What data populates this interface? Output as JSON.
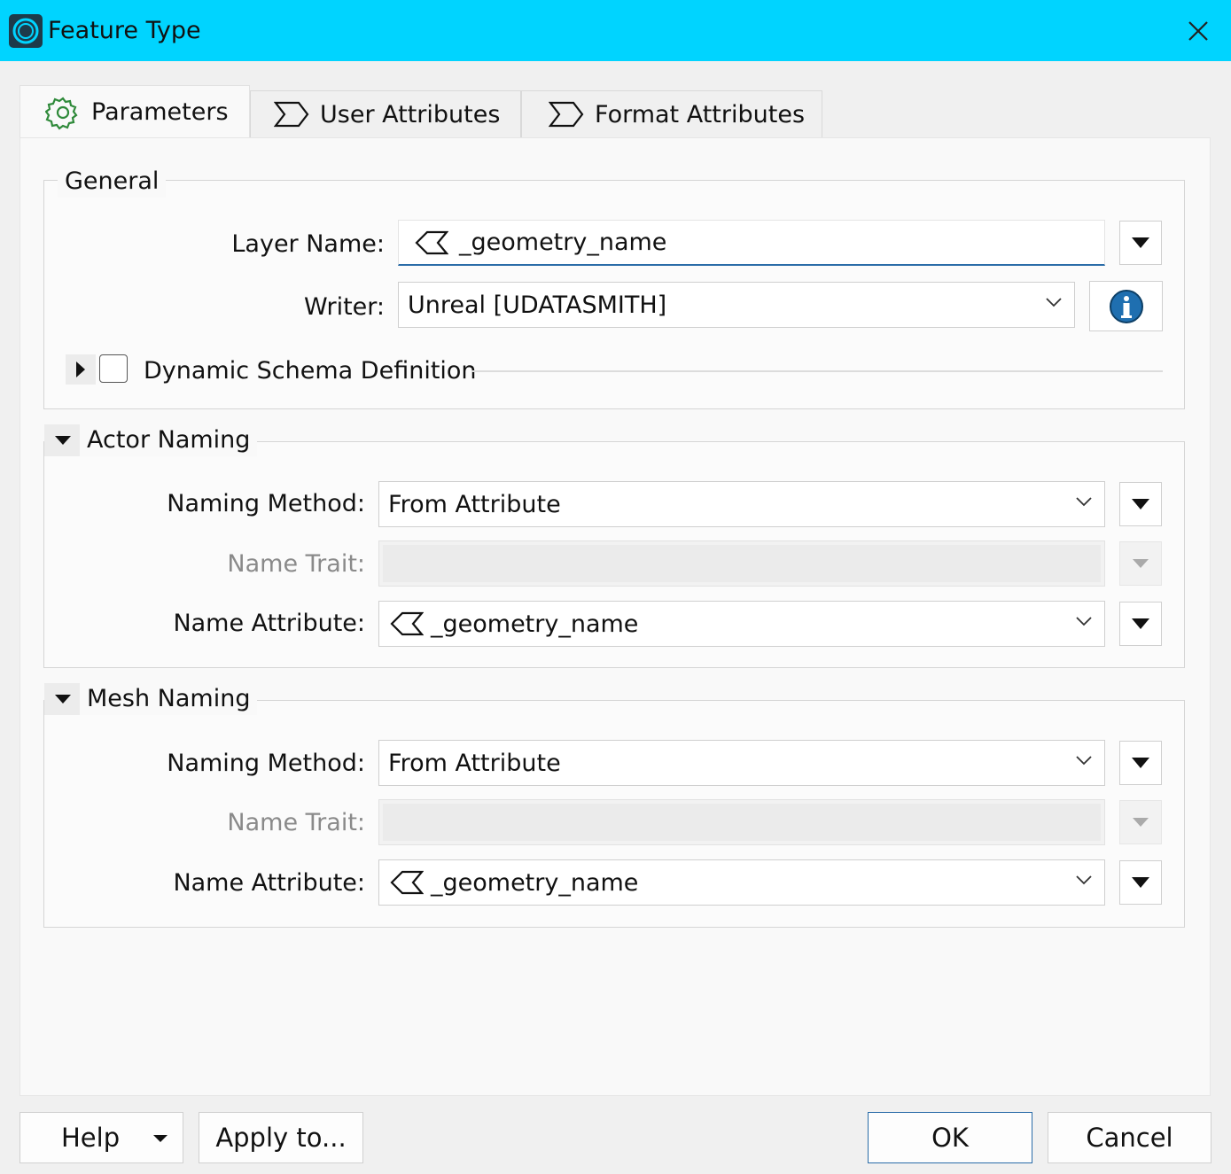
{
  "window": {
    "title": "Feature Type",
    "accent_color": "#00d4ff"
  },
  "tabs": [
    {
      "label": "Parameters",
      "icon": "gear-icon",
      "active": true
    },
    {
      "label": "User Attributes",
      "icon": "sigma-icon",
      "active": false
    },
    {
      "label": "Format Attributes",
      "icon": "sigma-icon",
      "active": false
    }
  ],
  "general": {
    "title": "General",
    "layer_name_label": "Layer Name:",
    "layer_name_value": "_geometry_name",
    "writer_label": "Writer:",
    "writer_value": "Unreal [UDATASMITH]",
    "dynamic_schema_label": "Dynamic Schema Definition",
    "dynamic_schema_checked": false
  },
  "actor_naming": {
    "title": "Actor Naming",
    "naming_method_label": "Naming Method:",
    "naming_method_value": "From  Attribute",
    "name_trait_label": "Name Trait:",
    "name_trait_value": "",
    "name_attribute_label": "Name Attribute:",
    "name_attribute_value": "_geometry_name"
  },
  "mesh_naming": {
    "title": "Mesh Naming",
    "naming_method_label": "Naming Method:",
    "naming_method_value": "From  Attribute",
    "name_trait_label": "Name Trait:",
    "name_trait_value": "",
    "name_attribute_label": "Name Attribute:",
    "name_attribute_value": "_geometry_name"
  },
  "footer": {
    "help_label": "Help",
    "apply_label": "Apply to...",
    "ok_label": "OK",
    "cancel_label": "Cancel"
  }
}
